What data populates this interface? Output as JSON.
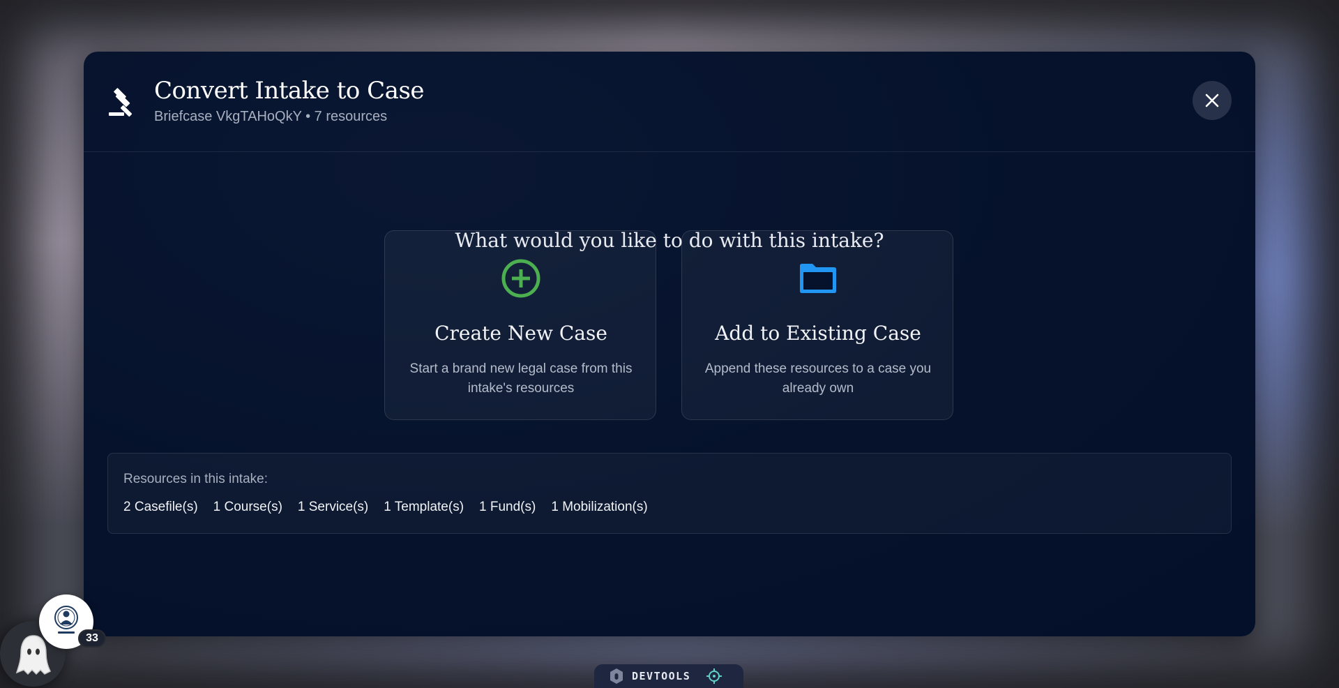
{
  "modal": {
    "title": "Convert Intake to Case",
    "subtitle": "Briefcase VkgTAHoQkY • 7 resources",
    "question": "What would you like to do with this intake?"
  },
  "options": [
    {
      "title": "Create New Case",
      "description": "Start a brand new legal case from this intake's resources",
      "icon": "plus-circle-icon",
      "color": "#4caf50"
    },
    {
      "title": "Add to Existing Case",
      "description": "Append these resources to a case you already own",
      "icon": "folder-icon",
      "color": "#2196f3"
    }
  ],
  "resources": {
    "label": "Resources in this intake:",
    "items": [
      "2 Casefile(s)",
      "1 Course(s)",
      "1 Service(s)",
      "1 Template(s)",
      "1 Fund(s)",
      "1 Mobilization(s)"
    ]
  },
  "badge": {
    "count": "33"
  },
  "devtools": {
    "label": "DEVTOOLS"
  },
  "colors": {
    "accent_green": "#4caf50",
    "accent_blue": "#2196f3",
    "modal_bg": "#06122b",
    "devtools_icon": "#5fd3c4"
  }
}
